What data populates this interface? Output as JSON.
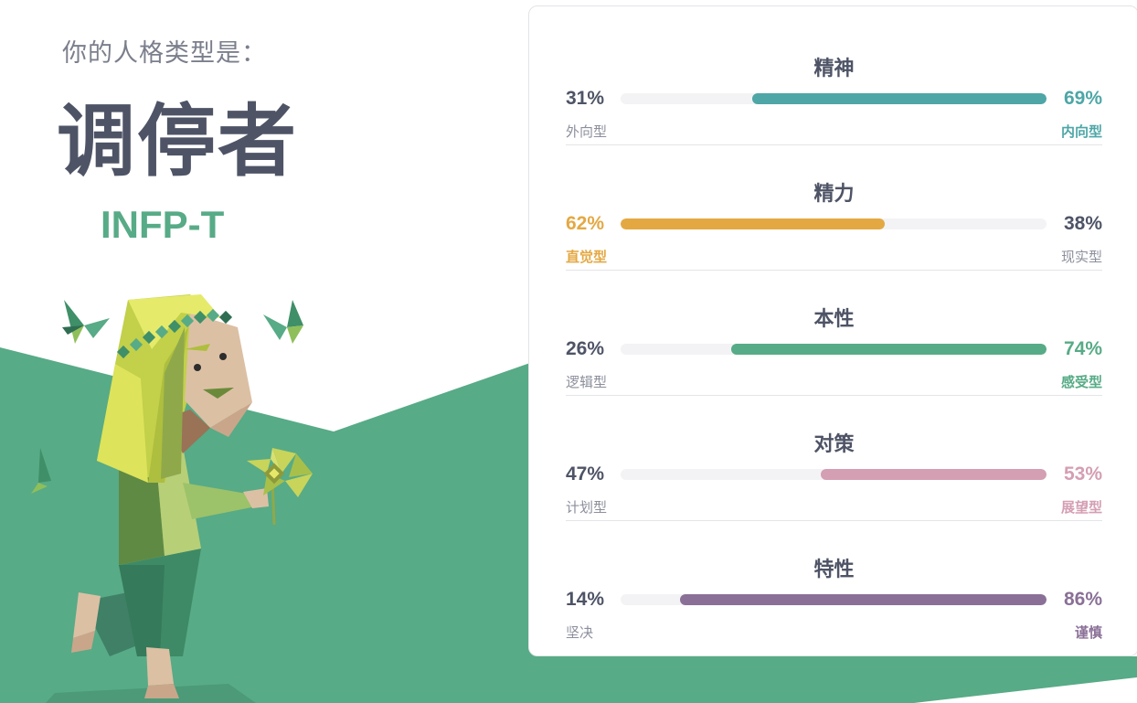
{
  "header": {
    "intro": "你的人格类型是：",
    "type_name": "调停者",
    "type_code": "INFP-T"
  },
  "colors": {
    "background_green": "#57ab86",
    "title_gray": "#4e5466",
    "track_gray": "#f3f3f5"
  },
  "traits": [
    {
      "title": "精神",
      "left_pct": "31%",
      "right_pct": "69%",
      "left_label": "外向型",
      "right_label": "内向型",
      "dominant": "right",
      "fill_fraction": 0.69,
      "color": "#4ea6a6"
    },
    {
      "title": "精力",
      "left_pct": "62%",
      "right_pct": "38%",
      "left_label": "直觉型",
      "right_label": "现实型",
      "dominant": "left",
      "fill_fraction": 0.62,
      "color": "#e4a843"
    },
    {
      "title": "本性",
      "left_pct": "26%",
      "right_pct": "74%",
      "left_label": "逻辑型",
      "right_label": "感受型",
      "dominant": "right",
      "fill_fraction": 0.74,
      "color": "#57ab86"
    },
    {
      "title": "对策",
      "left_pct": "47%",
      "right_pct": "53%",
      "left_label": "计划型",
      "right_label": "展望型",
      "dominant": "right",
      "fill_fraction": 0.53,
      "color": "#d49eb3"
    },
    {
      "title": "特性",
      "left_pct": "14%",
      "right_pct": "86%",
      "left_label": "坚决",
      "right_label": "谨慎",
      "dominant": "right",
      "fill_fraction": 0.86,
      "color": "#8a7097"
    }
  ]
}
